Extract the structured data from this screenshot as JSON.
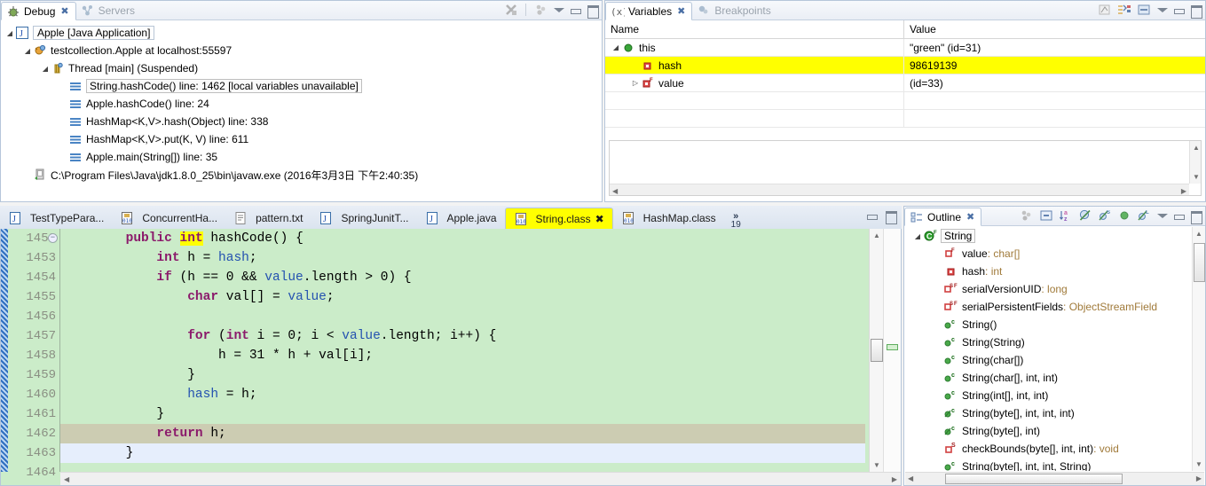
{
  "debug_view": {
    "tabs": [
      {
        "label": "Debug",
        "icon": "debug-icon",
        "active": true,
        "closeable": true
      },
      {
        "label": "Servers",
        "icon": "servers-icon",
        "active": false,
        "closeable": false
      }
    ],
    "toolbar": [
      {
        "name": "disconnect-icon"
      },
      {
        "name": "threads-icon"
      },
      {
        "name": "view-menu-icon"
      },
      {
        "name": "minimize-icon"
      },
      {
        "name": "maximize-icon"
      }
    ],
    "tree": [
      {
        "indent": 0,
        "twisty": "◢",
        "icon": "java-application-icon",
        "label": "Apple [Java Application]",
        "style": "boxed"
      },
      {
        "indent": 1,
        "twisty": "◢",
        "icon": "debug-target-icon",
        "label": "testcollection.Apple at localhost:55597",
        "style": ""
      },
      {
        "indent": 2,
        "twisty": "◢",
        "icon": "thread-icon",
        "label": "Thread [main] (Suspended)",
        "style": ""
      },
      {
        "indent": 3,
        "twisty": "",
        "icon": "stack-frame-icon",
        "label": "String.hashCode() line: 1462 [local variables unavailable]",
        "style": "selbox"
      },
      {
        "indent": 3,
        "twisty": "",
        "icon": "stack-frame-icon",
        "label": "Apple.hashCode() line: 24",
        "style": ""
      },
      {
        "indent": 3,
        "twisty": "",
        "icon": "stack-frame-icon",
        "label": "HashMap<K,V>.hash(Object) line: 338",
        "style": ""
      },
      {
        "indent": 3,
        "twisty": "",
        "icon": "stack-frame-icon",
        "label": "HashMap<K,V>.put(K, V) line: 611",
        "style": ""
      },
      {
        "indent": 3,
        "twisty": "",
        "icon": "stack-frame-icon",
        "label": "Apple.main(String[]) line: 35",
        "style": ""
      },
      {
        "indent": 1,
        "twisty": "",
        "icon": "process-icon",
        "label": "C:\\Program Files\\Java\\jdk1.8.0_25\\bin\\javaw.exe (2016年3月3日 下午2:40:35)",
        "style": ""
      }
    ]
  },
  "variables_view": {
    "tabs": [
      {
        "label": "Variables",
        "icon": "variables-icon",
        "active": true,
        "closeable": true
      },
      {
        "label": "Breakpoints",
        "icon": "breakpoints-icon",
        "active": false,
        "closeable": false
      }
    ],
    "toolbar": [
      {
        "name": "show-logical-structure-icon"
      },
      {
        "name": "collapse-all-icon"
      },
      {
        "name": "layout-icon"
      },
      {
        "name": "view-menu-icon"
      },
      {
        "name": "minimize-icon"
      },
      {
        "name": "maximize-icon"
      }
    ],
    "columns": [
      "Name",
      "Value"
    ],
    "rows": [
      {
        "indent": 0,
        "twisty": "◢",
        "icon": "object-icon",
        "name": "this",
        "value": "\"green\" (id=31)",
        "highlight": false
      },
      {
        "indent": 1,
        "twisty": "",
        "icon": "field-private-icon",
        "name": "hash",
        "value": "98619139",
        "highlight": true
      },
      {
        "indent": 1,
        "twisty": "▷",
        "icon": "field-final-icon",
        "name": "value",
        "value": "(id=33)",
        "highlight": false
      },
      {
        "indent": 0,
        "twisty": "",
        "icon": "",
        "name": "",
        "value": "",
        "highlight": false
      },
      {
        "indent": 0,
        "twisty": "",
        "icon": "",
        "name": "",
        "value": "",
        "highlight": false
      }
    ],
    "detail_text": ""
  },
  "editor": {
    "tabs": [
      {
        "label": "TestTypePara...",
        "icon": "java-file-icon",
        "active": false,
        "highlighted": false,
        "closeable": false
      },
      {
        "label": "ConcurrentHa...",
        "icon": "class-file-icon",
        "active": false,
        "highlighted": false,
        "closeable": false
      },
      {
        "label": "pattern.txt",
        "icon": "text-file-icon",
        "active": false,
        "highlighted": false,
        "closeable": false
      },
      {
        "label": "SpringJunitT...",
        "icon": "java-file-icon",
        "active": false,
        "highlighted": false,
        "closeable": false
      },
      {
        "label": "Apple.java",
        "icon": "java-file-icon",
        "active": false,
        "highlighted": false,
        "closeable": false
      },
      {
        "label": "String.class",
        "icon": "class-file-icon",
        "active": true,
        "highlighted": true,
        "closeable": true
      },
      {
        "label": "HashMap.class",
        "icon": "class-file-icon",
        "active": false,
        "highlighted": false,
        "closeable": false
      }
    ],
    "overflow_chevron": "»",
    "overflow_count": "19",
    "toolbar": [
      {
        "name": "minimize-icon"
      },
      {
        "name": "maximize-icon"
      }
    ],
    "first_line_number": 1452,
    "lines": [
      {
        "num": "1452",
        "state": "normal",
        "marker": "green-triangle",
        "fold": "⊖",
        "tokens": [
          {
            "t": "        ",
            "c": ""
          },
          {
            "t": "public ",
            "c": "kw"
          },
          {
            "t": "int",
            "c": "kw hlw"
          },
          {
            "t": " hashCode() {",
            "c": ""
          }
        ]
      },
      {
        "num": "1453",
        "state": "normal",
        "marker": "",
        "fold": "",
        "tokens": [
          {
            "t": "            ",
            "c": ""
          },
          {
            "t": "int",
            "c": "kw"
          },
          {
            "t": " h = ",
            "c": ""
          },
          {
            "t": "hash",
            "c": "fld"
          },
          {
            "t": ";",
            "c": ""
          }
        ]
      },
      {
        "num": "1454",
        "state": "normal",
        "marker": "",
        "fold": "",
        "tokens": [
          {
            "t": "            ",
            "c": ""
          },
          {
            "t": "if",
            "c": "kw"
          },
          {
            "t": " (h == 0 && ",
            "c": ""
          },
          {
            "t": "value",
            "c": "fld"
          },
          {
            "t": ".length > 0) {",
            "c": ""
          }
        ]
      },
      {
        "num": "1455",
        "state": "normal",
        "marker": "",
        "fold": "",
        "tokens": [
          {
            "t": "                ",
            "c": ""
          },
          {
            "t": "char",
            "c": "kw"
          },
          {
            "t": " val[] = ",
            "c": ""
          },
          {
            "t": "value",
            "c": "fld"
          },
          {
            "t": ";",
            "c": ""
          }
        ]
      },
      {
        "num": "1456",
        "state": "normal",
        "marker": "",
        "fold": "",
        "tokens": [
          {
            "t": "",
            "c": ""
          }
        ]
      },
      {
        "num": "1457",
        "state": "normal",
        "marker": "",
        "fold": "",
        "tokens": [
          {
            "t": "                ",
            "c": ""
          },
          {
            "t": "for",
            "c": "kw"
          },
          {
            "t": " (",
            "c": ""
          },
          {
            "t": "int",
            "c": "kw"
          },
          {
            "t": " i = 0; i < ",
            "c": ""
          },
          {
            "t": "value",
            "c": "fld"
          },
          {
            "t": ".length; i++) {",
            "c": ""
          }
        ]
      },
      {
        "num": "1458",
        "state": "normal",
        "marker": "",
        "fold": "",
        "tokens": [
          {
            "t": "                    h = 31 * h + val[i];",
            "c": ""
          }
        ]
      },
      {
        "num": "1459",
        "state": "normal",
        "marker": "",
        "fold": "",
        "tokens": [
          {
            "t": "                }",
            "c": ""
          }
        ]
      },
      {
        "num": "1460",
        "state": "normal",
        "marker": "",
        "fold": "",
        "tokens": [
          {
            "t": "                ",
            "c": ""
          },
          {
            "t": "hash",
            "c": "fld"
          },
          {
            "t": " = h;",
            "c": ""
          }
        ]
      },
      {
        "num": "1461",
        "state": "normal",
        "marker": "",
        "fold": "",
        "tokens": [
          {
            "t": "            }",
            "c": ""
          }
        ]
      },
      {
        "num": "1462",
        "state": "current",
        "marker": "blue-arrow",
        "fold": "",
        "tokens": [
          {
            "t": "            ",
            "c": ""
          },
          {
            "t": "return",
            "c": "kw"
          },
          {
            "t": " h;",
            "c": ""
          }
        ]
      },
      {
        "num": "1463",
        "state": "cursor",
        "marker": "",
        "fold": "",
        "tokens": [
          {
            "t": "        }",
            "c": ""
          }
        ]
      },
      {
        "num": "1464",
        "state": "normal",
        "marker": "",
        "fold": "",
        "tokens": [
          {
            "t": "",
            "c": ""
          }
        ]
      }
    ]
  },
  "outline_view": {
    "tabs": [
      {
        "label": "Outline",
        "icon": "outline-icon",
        "active": true,
        "closeable": true
      }
    ],
    "toolbar": [
      {
        "name": "focus-on-selection-icon"
      },
      {
        "name": "collapse-all-icon"
      },
      {
        "name": "sort-alphabetically-icon"
      },
      {
        "name": "hide-fields-icon"
      },
      {
        "name": "hide-static-icon"
      },
      {
        "name": "hide-nonpublic-icon"
      },
      {
        "name": "hide-local-types-icon"
      },
      {
        "name": "view-menu-icon"
      },
      {
        "name": "minimize-icon"
      },
      {
        "name": "maximize-icon"
      }
    ],
    "items": [
      {
        "indent": 0,
        "twisty": "◢",
        "icon": "class-public-final-icon",
        "name": "String",
        "type": "",
        "selected": true
      },
      {
        "indent": 1,
        "twisty": "",
        "icon": "field-private-final-icon",
        "name": "value",
        "type": " : char[]",
        "selected": false
      },
      {
        "indent": 1,
        "twisty": "",
        "icon": "field-private-icon",
        "name": "hash",
        "type": " : int",
        "selected": false
      },
      {
        "indent": 1,
        "twisty": "",
        "icon": "field-private-static-final-icon",
        "name": "serialVersionUID",
        "type": " : long",
        "selected": false
      },
      {
        "indent": 1,
        "twisty": "",
        "icon": "field-private-static-final-icon",
        "name": "serialPersistentFields",
        "type": " : ObjectStreamField",
        "selected": false
      },
      {
        "indent": 1,
        "twisty": "",
        "icon": "method-public-constructor-icon",
        "name": "String()",
        "type": "",
        "selected": false
      },
      {
        "indent": 1,
        "twisty": "",
        "icon": "method-public-constructor-icon",
        "name": "String(String)",
        "type": "",
        "selected": false
      },
      {
        "indent": 1,
        "twisty": "",
        "icon": "method-public-constructor-icon",
        "name": "String(char[])",
        "type": "",
        "selected": false
      },
      {
        "indent": 1,
        "twisty": "",
        "icon": "method-public-constructor-icon",
        "name": "String(char[], int, int)",
        "type": "",
        "selected": false
      },
      {
        "indent": 1,
        "twisty": "",
        "icon": "method-public-constructor-icon",
        "name": "String(int[], int, int)",
        "type": "",
        "selected": false
      },
      {
        "indent": 1,
        "twisty": "",
        "icon": "method-deprecated-constructor-icon",
        "name": "String(byte[], int, int, int)",
        "type": "",
        "selected": false
      },
      {
        "indent": 1,
        "twisty": "",
        "icon": "method-deprecated-constructor-icon",
        "name": "String(byte[], int)",
        "type": "",
        "selected": false
      },
      {
        "indent": 1,
        "twisty": "",
        "icon": "method-private-static-icon",
        "name": "checkBounds(byte[], int, int)",
        "type": " : void",
        "selected": false
      },
      {
        "indent": 1,
        "twisty": "",
        "icon": "method-public-constructor-icon",
        "name": "String(byte[], int, int, String)",
        "type": "",
        "selected": false
      }
    ]
  },
  "colors": {
    "editor_background": "#cbecc9",
    "current_line_highlight": "#ccccb2",
    "cursor_line_highlight": "#e6eefc",
    "search_highlight": "#ffff00",
    "keyword": "#8b1a6b",
    "field": "#2452b0",
    "type_annotation": "#a07a3a"
  }
}
